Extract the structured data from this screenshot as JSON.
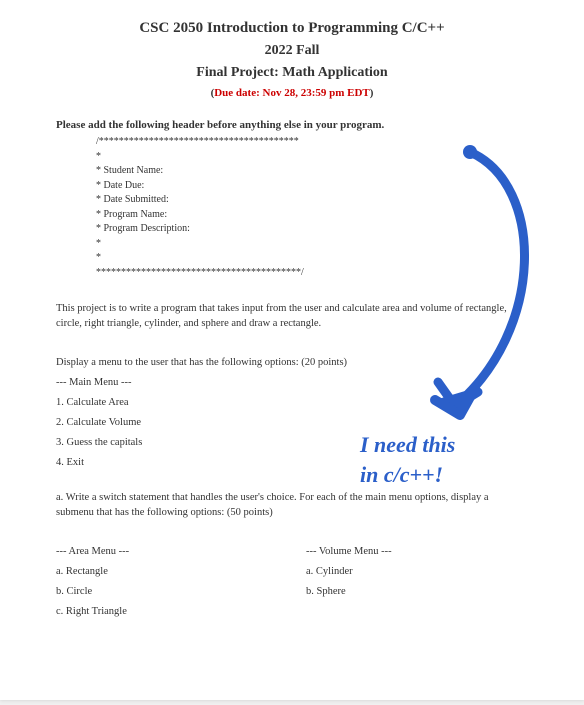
{
  "header": {
    "course": "CSC 2050 Introduction to Programming C/C++",
    "term": "2022 Fall",
    "project": "Final Project: Math Application",
    "due_prefix": "(",
    "due_text": "Due date: Nov 28, 23:59 pm EDT",
    "due_suffix": ")"
  },
  "instruction": "Please add the following header before anything else in your program.",
  "code_header": "/****************************************\n*\n* Student Name:\n* Date Due:\n* Date Submitted:\n* Program Name:\n* Program Description:\n*\n*\n*****************************************/",
  "description": "This project is to write a program that takes input from the user and calculate area and volume of rectangle, circle, right triangle, cylinder, and sphere and draw a rectangle.",
  "menu_intro": "Display a menu to the user that has the following options: (20 points)",
  "main_menu": {
    "title": "--- Main Menu ---",
    "items": [
      "1. Calculate Area",
      "2. Calculate Volume",
      "3. Guess the capitals",
      "4. Exit"
    ]
  },
  "submenu_intro": "a. Write a switch statement that handles the user's choice. For each of the main menu options, display a submenu that has the following options: (50 points)",
  "area_menu": {
    "title": "--- Area Menu ---",
    "items": [
      "a. Rectangle",
      "b. Circle",
      "c. Right Triangle"
    ]
  },
  "volume_menu": {
    "title": "--- Volume Menu ---",
    "items": [
      "a. Cylinder",
      "b. Sphere"
    ]
  },
  "annotation": {
    "line1": "I need this",
    "line2": "in c/c++!"
  }
}
